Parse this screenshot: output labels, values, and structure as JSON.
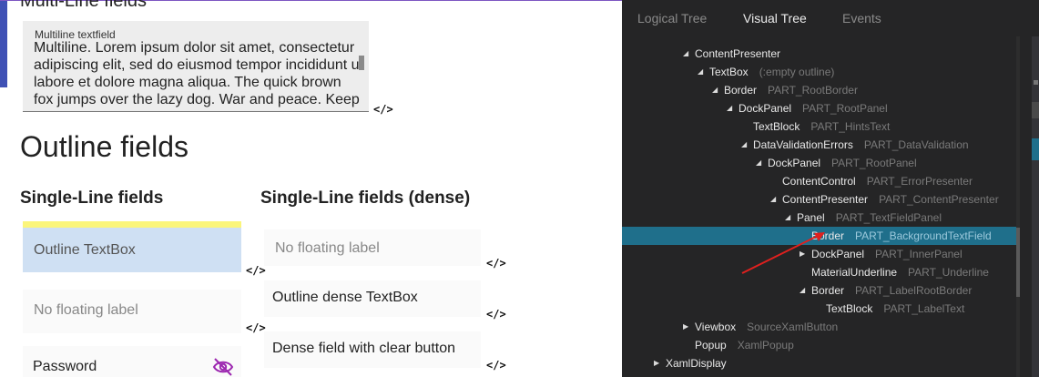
{
  "app": {
    "multi_title": "Multi-Line fields",
    "multiline": {
      "hint": "Multiline textfield",
      "text": "Multiline. Lorem ipsum dolor sit amet, consectetur adipiscing elit, sed do eiusmod tempor incididunt ut labore  et dolore magna aliqua. The quick brown fox jumps over the   lazy dog. War and peace. Keep"
    },
    "code_icon": "</>",
    "outline_heading": "Outline fields",
    "col1_heading": "Single-Line fields",
    "col2_heading": "Single-Line fields (dense)",
    "fields": {
      "outline_textbox": "Outline TextBox",
      "no_floating_label": "No floating label",
      "password": "Password",
      "dense_no_floating": "No floating label",
      "outline_dense": "Outline dense TextBox",
      "dense_clear": "Dense field with clear button"
    },
    "colors": {
      "accent_purple": "#9c27b0",
      "active_fill": "#cfe0f3",
      "focus_bar": "#fbf57a",
      "indigo": "#3f51b5"
    }
  },
  "devtools": {
    "tabs": [
      "Logical Tree",
      "Visual Tree",
      "Events"
    ],
    "active_tab": "Visual Tree",
    "tree": [
      {
        "toggle": "◢",
        "name": "ContentPresenter",
        "part": ""
      },
      {
        "toggle": "◢",
        "name": "TextBox",
        "part": "(:empty outline)"
      },
      {
        "toggle": "◢",
        "name": "Border",
        "part": "PART_RootBorder"
      },
      {
        "toggle": "◢",
        "name": "DockPanel",
        "part": "PART_RootPanel"
      },
      {
        "toggle": "",
        "name": "TextBlock",
        "part": "PART_HintsText"
      },
      {
        "toggle": "◢",
        "name": "DataValidationErrors",
        "part": "PART_DataValidation"
      },
      {
        "toggle": "◢",
        "name": "DockPanel",
        "part": "PART_RootPanel"
      },
      {
        "toggle": "",
        "name": "ContentControl",
        "part": "PART_ErrorPresenter"
      },
      {
        "toggle": "◢",
        "name": "ContentPresenter",
        "part": "PART_ContentPresenter"
      },
      {
        "toggle": "◢",
        "name": "Panel",
        "part": "PART_TextFieldPanel"
      },
      {
        "toggle": "",
        "name": "Border",
        "part": "PART_BackgroundTextField"
      },
      {
        "toggle": "▶",
        "name": "DockPanel",
        "part": "PART_InnerPanel"
      },
      {
        "toggle": "",
        "name": "MaterialUnderline",
        "part": "PART_Underline"
      },
      {
        "toggle": "◢",
        "name": "Border",
        "part": "PART_LabelRootBorder"
      },
      {
        "toggle": "",
        "name": "TextBlock",
        "part": "PART_LabelText"
      },
      {
        "toggle": "▶",
        "name": "Viewbox",
        "part": "SourceXamlButton"
      },
      {
        "toggle": "",
        "name": "Popup",
        "part": "XamlPopup"
      },
      {
        "toggle": "▶",
        "name": "XamlDisplay",
        "part": ""
      }
    ],
    "selected_index": 10,
    "colors": {
      "selected": "#1f6f8b",
      "annotation_arrow": "#e0201e"
    }
  }
}
